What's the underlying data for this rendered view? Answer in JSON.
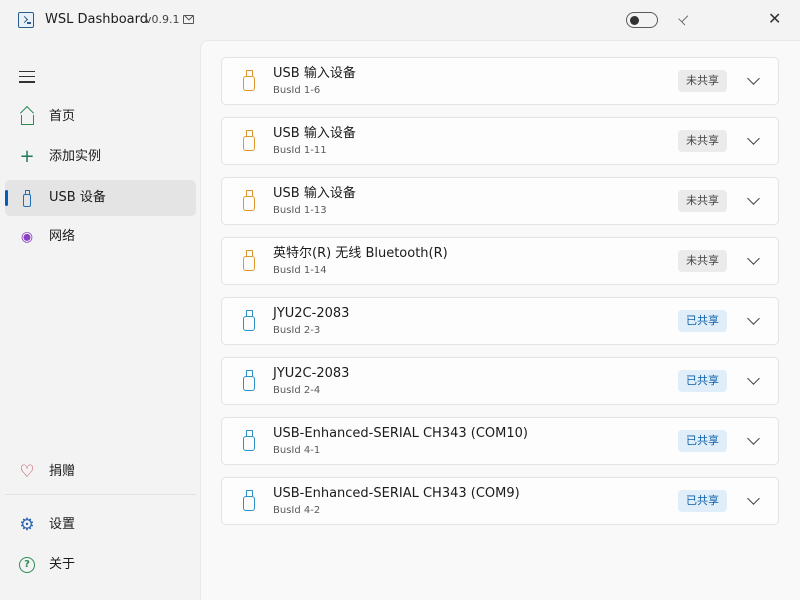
{
  "titlebar": {
    "app_title": "WSL Dashboard",
    "version": "v0.9.1",
    "icons": [
      "terminal-icon",
      "mail-icon",
      "theme-toggle",
      "pin-icon",
      "close-icon"
    ],
    "close_glyph": "✕",
    "pin_glyph": "📌"
  },
  "sidebar": {
    "items": [
      {
        "label": "首页",
        "icon": "home-icon"
      },
      {
        "label": "添加实例",
        "icon": "plus-icon"
      },
      {
        "label": "USB 设备",
        "icon": "usb-icon",
        "active": true
      },
      {
        "label": "网络",
        "icon": "network-icon"
      }
    ],
    "bottom": [
      {
        "label": "捐赠",
        "icon": "heart-icon"
      },
      {
        "label": "设置",
        "icon": "gear-icon"
      },
      {
        "label": "关于",
        "icon": "help-icon"
      }
    ],
    "glyphs": {
      "plus": "+",
      "wifi": "📶",
      "heart": "♡",
      "gear": "⚙",
      "help": "?"
    }
  },
  "devices": [
    {
      "name": "USB 输入设备",
      "busid": "BusId 1-6",
      "status": "未共享",
      "shared": false
    },
    {
      "name": "USB 输入设备",
      "busid": "BusId 1-11",
      "status": "未共享",
      "shared": false
    },
    {
      "name": "USB 输入设备",
      "busid": "BusId 1-13",
      "status": "未共享",
      "shared": false
    },
    {
      "name": "英特尔(R) 无线 Bluetooth(R)",
      "busid": "BusId 1-14",
      "status": "未共享",
      "shared": false
    },
    {
      "name": "JYU2C-2083",
      "busid": "BusId 2-3",
      "status": "已共享",
      "shared": true
    },
    {
      "name": "JYU2C-2083",
      "busid": "BusId 2-4",
      "status": "已共享",
      "shared": true
    },
    {
      "name": "USB-Enhanced-SERIAL CH343 (COM10)",
      "busid": "BusId 4-1",
      "status": "已共享",
      "shared": true
    },
    {
      "name": "USB-Enhanced-SERIAL CH343 (COM9)",
      "busid": "BusId 4-2",
      "status": "已共享",
      "shared": true
    }
  ],
  "colors": {
    "unshared_icon": "#e0952e",
    "shared_icon": "#2b8fc9",
    "accent": "#005fb8"
  }
}
